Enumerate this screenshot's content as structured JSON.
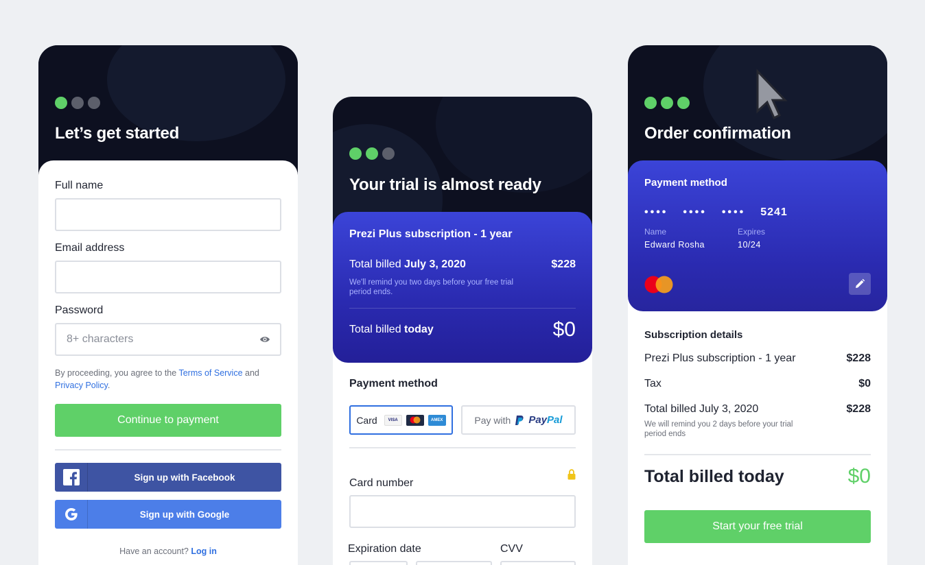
{
  "screen1": {
    "title": "Let’s get started",
    "fields": {
      "full_name_label": "Full name",
      "email_label": "Email address",
      "password_label": "Password",
      "password_placeholder": "8+ characters"
    },
    "terms_prefix": "By proceeding, you agree to the ",
    "terms_link": "Terms of Service",
    "terms_and": " and",
    "privacy_link": "Privacy Policy",
    "terms_suffix": ".",
    "continue_button": "Continue to payment",
    "facebook_button": "Sign up with Facebook",
    "google_button": "Sign up with Google",
    "have_account": "Have an account? ",
    "login_link": "Log in"
  },
  "screen2": {
    "title": "Your trial is almost ready",
    "plan": "Prezi Plus subscription - 1 year",
    "billed_prefix": "Total billed ",
    "billed_date": "July 3, 2020",
    "billed_amount": "$228",
    "reminder": "We'll remind you two days before your free trial period ends.",
    "today_prefix": "Total billed ",
    "today_word": "today",
    "today_amount": "$0",
    "payment_method_title": "Payment method",
    "card_option": "Card",
    "paypal_prefix": "Pay with",
    "paypal_logo_a": "Pay",
    "paypal_logo_b": "Pal",
    "card_logos": [
      "VISA",
      "",
      "AMEX"
    ],
    "card_number_label": "Card number",
    "expiration_label": "Expiration date",
    "cvv_label": "CVV"
  },
  "screen3": {
    "title": "Order confirmation",
    "payment_method_title": "Payment method",
    "card_masked": [
      "••••",
      "••••",
      "••••"
    ],
    "card_last4": "5241",
    "name_label": "Name",
    "name_value": "Edward Rosha",
    "expires_label": "Expires",
    "expires_value": "10/24",
    "subscription_title": "Subscription details",
    "rows": [
      {
        "label": "Prezi Plus subscription - 1 year",
        "value": "$228"
      },
      {
        "label": "Tax",
        "value": "$0"
      },
      {
        "label": "Total billed July 3, 2020",
        "value": "$228"
      }
    ],
    "reminder": "We will remind you 2 days before your trial period ends",
    "total_today_label": "Total billed today",
    "total_today_value": "$0",
    "start_button": "Start your free trial"
  },
  "colors": {
    "accent_green": "#5fd068",
    "dark_header": "#0d1020",
    "card_blue": "#2a2ab0",
    "link_blue": "#2f6fe0",
    "facebook": "#3e54a3",
    "google": "#4c7ee8"
  }
}
